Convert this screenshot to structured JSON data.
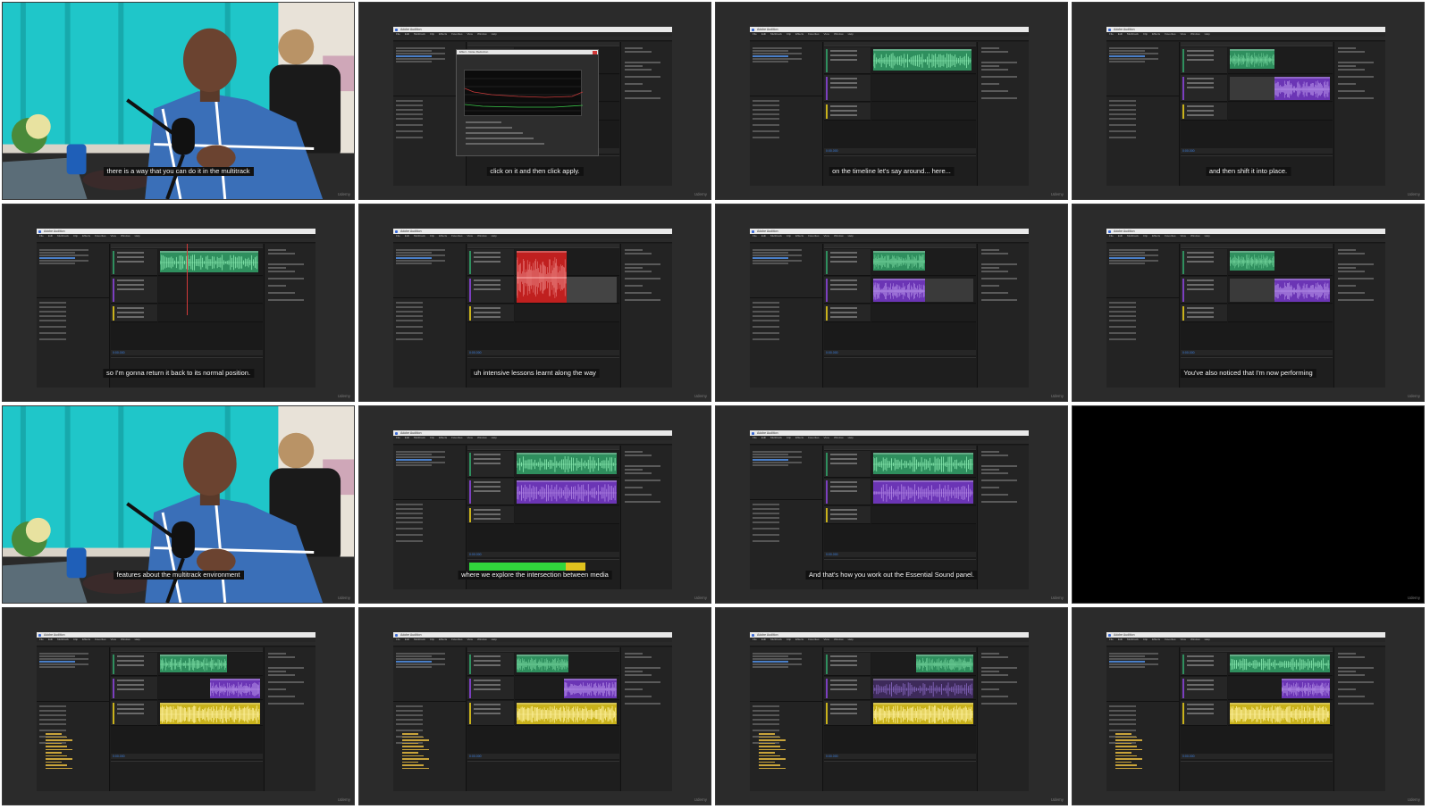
{
  "app": {
    "title": "Adobe Audition",
    "menu": [
      "File",
      "Edit",
      "Multitrack",
      "Clip",
      "Effects",
      "Favorites",
      "View",
      "Window",
      "Help"
    ],
    "timecode": "0:00.000"
  },
  "watermark": "Udemy",
  "dialog_title": "Effect - Noise Reduction",
  "tiles": [
    {
      "kind": "webcam",
      "caption": "there is a way that you can do it in the multitrack"
    },
    {
      "kind": "dialog",
      "caption": "click on it and then click apply."
    },
    {
      "kind": "single-green",
      "caption": "on the timeline let's say around... here..."
    },
    {
      "kind": "green-purple",
      "caption": "and then shift it into place."
    },
    {
      "kind": "single-green-playhead",
      "caption": "so I'm gonna return it back to its normal position."
    },
    {
      "kind": "red",
      "caption": "uh intensive lessons learnt along the way"
    },
    {
      "kind": "green-purple-short",
      "caption": ""
    },
    {
      "kind": "green-purple",
      "caption": "You've also noticed that I'm now performing"
    },
    {
      "kind": "webcam",
      "caption": "features about the multitrack environment"
    },
    {
      "kind": "green-purple-meter",
      "caption": "where we explore the intersection between media"
    },
    {
      "kind": "green-purple-long",
      "caption": "And that's how you work out the Essential Sound panel."
    },
    {
      "kind": "black",
      "caption": ""
    },
    {
      "kind": "three-track",
      "caption": ""
    },
    {
      "kind": "three-track-cut",
      "caption": ""
    },
    {
      "kind": "three-track-shift",
      "caption": ""
    },
    {
      "kind": "three-track-right",
      "caption": ""
    }
  ],
  "colors": {
    "green_clip": "#2f8f5e",
    "purple_clip": "#6b35b5",
    "red_clip": "#c0201f",
    "yellow_clip": "#c9b21b",
    "teal_curtain": "#1fc6c9",
    "shirt_blue": "#3a6fb8"
  }
}
